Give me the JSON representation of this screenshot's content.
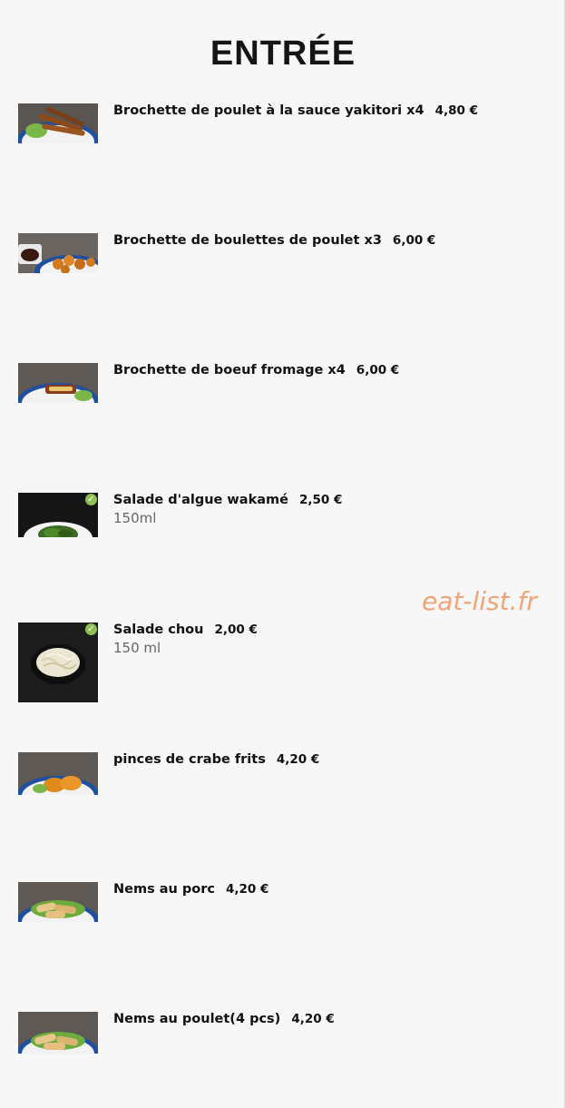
{
  "section": {
    "title": "ENTRÉE"
  },
  "watermark": "eat-list.fr",
  "items": [
    {
      "name": "Brochette de poulet à la sauce yakitori x4",
      "price": "4,80 €",
      "description": "",
      "vegetarian": false,
      "image_icon": "skewer-plate-icon"
    },
    {
      "name": "Brochette de boulettes de poulet x3",
      "price": "6,00 €",
      "description": "",
      "vegetarian": false,
      "image_icon": "meatball-plate-icon"
    },
    {
      "name": "Brochette de boeuf fromage x4",
      "price": "6,00 €",
      "description": "",
      "vegetarian": false,
      "image_icon": "beef-skewer-plate-icon"
    },
    {
      "name": "Salade d'algue wakamé",
      "price": "2,50 €",
      "description": "150ml",
      "vegetarian": true,
      "image_icon": "seaweed-salad-icon"
    },
    {
      "name": "Salade chou",
      "price": "2,00 €",
      "description": "150 ml",
      "vegetarian": true,
      "image_icon": "cabbage-salad-icon"
    },
    {
      "name": "pinces de crabe frits",
      "price": "4,20 €",
      "description": "",
      "vegetarian": false,
      "image_icon": "fried-crab-claws-icon"
    },
    {
      "name": "Nems au porc",
      "price": "4,20 €",
      "description": "",
      "vegetarian": false,
      "image_icon": "spring-rolls-icon"
    },
    {
      "name": "Nems au poulet(4 pcs)",
      "price": "4,20 €",
      "description": "",
      "vegetarian": false,
      "image_icon": "spring-rolls-icon"
    }
  ],
  "colors": {
    "background": "#f7f7f7",
    "veg_badge": "#8cc152",
    "watermark": "#f0a478"
  }
}
